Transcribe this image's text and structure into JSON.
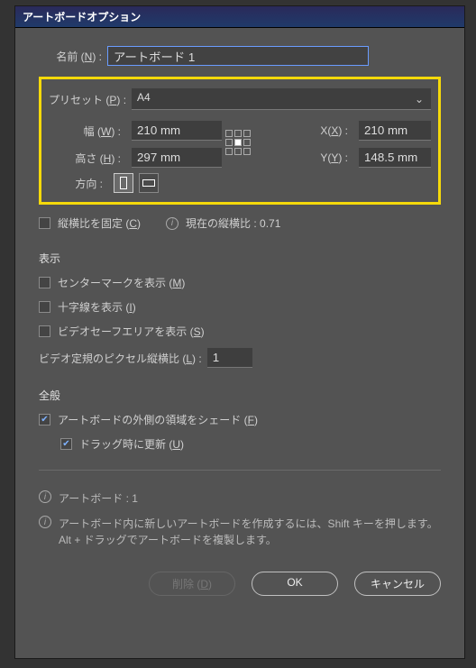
{
  "title": "アートボードオプション",
  "name": {
    "label_prefix": "名前 (",
    "label_key": "N",
    "label_suffix": ") :",
    "value": "アートボード 1"
  },
  "preset": {
    "label_prefix": "プリセット (",
    "label_key": "P",
    "label_suffix": ") :",
    "value": "A4"
  },
  "width": {
    "label_prefix": "幅 (",
    "label_key": "W",
    "label_suffix": ") :",
    "value": "210 mm"
  },
  "height": {
    "label_prefix": "高さ (",
    "label_key": "H",
    "label_suffix": ") :",
    "value": "297 mm"
  },
  "x": {
    "label_prefix": "X(",
    "label_key": "X",
    "label_suffix": ") :",
    "value": "210 mm"
  },
  "y": {
    "label_prefix": "Y(",
    "label_key": "Y",
    "label_suffix": ") :",
    "value": "148.5 mm"
  },
  "orientation_label": "方向 :",
  "constrain": {
    "label_prefix": "縦横比を固定 (",
    "label_key": "C",
    "label_suffix": ")",
    "checked": false
  },
  "ratio_info": "現在の縦横比 : 0.71",
  "display": {
    "title": "表示",
    "center_mark": {
      "label_prefix": "センターマークを表示 (",
      "label_key": "M",
      "label_suffix": ")",
      "checked": false
    },
    "cross_hairs": {
      "label_prefix": "十字線を表示 (",
      "label_key": "I",
      "label_suffix": ")",
      "checked": false
    },
    "video_safe": {
      "label_prefix": "ビデオセーフエリアを表示 (",
      "label_key": "S",
      "label_suffix": ")",
      "checked": false
    },
    "pixel_ratio": {
      "label_prefix": "ビデオ定規のピクセル縦横比 (",
      "label_key": "L",
      "label_suffix": ") :",
      "value": "1"
    }
  },
  "general": {
    "title": "全般",
    "fade": {
      "label_prefix": "アートボードの外側の領域をシェード (",
      "label_key": "F",
      "label_suffix": ")",
      "checked": true
    },
    "update_drag": {
      "label_prefix": "ドラッグ時に更新 (",
      "label_key": "U",
      "label_suffix": ")",
      "checked": true
    }
  },
  "info": {
    "artboards": "アートボード : 1",
    "hint1": "アートボード内に新しいアートボードを作成するには、Shift キーを押します。",
    "hint2": "Alt + ドラッグでアートボードを複製します。"
  },
  "buttons": {
    "delete_prefix": "削除 (",
    "delete_key": "D",
    "delete_suffix": ")",
    "ok": "OK",
    "cancel": "キャンセル"
  }
}
